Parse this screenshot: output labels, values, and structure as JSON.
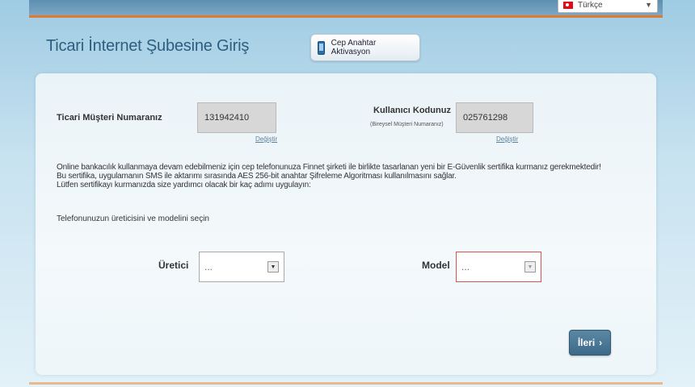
{
  "header": {
    "language": "Türkçe"
  },
  "page": {
    "title": "Ticari İnternet Şubesine Giriş",
    "activation_button": "Cep Anahtar Aktivasyon"
  },
  "form": {
    "customer_number_label": "Ticari Müşteri Numaranız",
    "customer_number_value": "131942410",
    "customer_change_link": "Değiştir",
    "user_code_label": "Kullanıcı Kodunuz",
    "user_code_sublabel": "(Bireysel Müşteri Numaranız)",
    "user_code_value": "025761298",
    "user_change_link": "Değiştir"
  },
  "info": {
    "line1": "Online bankacılık kullanmaya devam edebilmeniz için cep telefonunuza Finnet şirketi ile birlikte tasarlanan yeni bir E-Güvenlik sertifika kurmanız gerekmektedir!",
    "line2": "Bu sertifika, uygulamanın SMS ile aktarımı sırasında AES 256-bit anahtar Şifreleme Algoritması kullanılmasını sağlar.",
    "line3": "Lütfen sertifikayı kurmanızda size yardımcı olacak bir kaç adımı uygulayın:"
  },
  "selection": {
    "prompt": "Telefonunuzun üreticisini ve modelini seçin",
    "manufacturer_label": "Üretici",
    "manufacturer_value": "...",
    "model_label": "Model",
    "model_value": "..."
  },
  "actions": {
    "next_label": "İleri"
  },
  "colors": {
    "accent": "#e07a2e",
    "title": "#2e5e7e",
    "button": "#3c6a88",
    "invalid": "#d9534f"
  }
}
